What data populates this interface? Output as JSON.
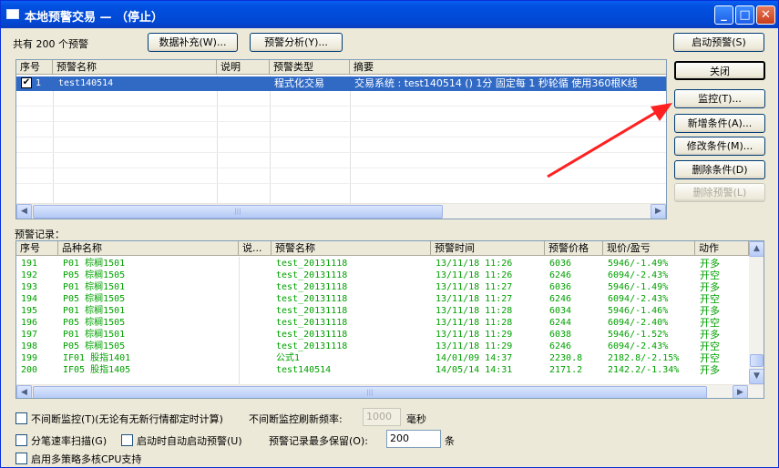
{
  "window": {
    "title": "本地预警交易 — （停止）"
  },
  "top": {
    "count_label": "共有 200 个预警",
    "data_supplement_btn": "数据补充(W)...",
    "alert_analysis_btn": "预警分析(Y)...",
    "start_alert_btn": "启动预警(S)"
  },
  "alerts_table": {
    "headers": [
      "序号",
      "预警名称",
      "说明",
      "预警类型",
      "摘要"
    ],
    "rows": [
      {
        "index": "1",
        "checked": true,
        "name": "test140514",
        "desc": "",
        "type": "程式化交易",
        "summary": "交易系统 : test140514 () 1分 固定每 1 秒轮循 使用360根K线"
      }
    ]
  },
  "side_buttons": {
    "close": "关闭",
    "monitor": "监控(T)...",
    "add_condition": "新增条件(A)...",
    "modify_condition": "修改条件(M)...",
    "delete_condition": "删除条件(D)",
    "delete_alert": "删除预警(L)"
  },
  "records": {
    "title": "预警记录：",
    "headers": [
      "序号",
      "品种名称",
      "说...",
      "预警名称",
      "预警时间",
      "预警价格",
      "现价/盈亏",
      "动作"
    ],
    "rows": [
      {
        "no": "191",
        "product": "P01  棕榈1501",
        "note": "",
        "alert": "test_20131118",
        "time": "13/11/18 11:26",
        "price": "6036",
        "pnl": "5946/-1.49%",
        "action": "开多"
      },
      {
        "no": "192",
        "product": "P05  棕榈1505",
        "note": "",
        "alert": "test_20131118",
        "time": "13/11/18 11:26",
        "price": "6246",
        "pnl": "6094/-2.43%",
        "action": "开空"
      },
      {
        "no": "193",
        "product": "P01  棕榈1501",
        "note": "",
        "alert": "test_20131118",
        "time": "13/11/18 11:27",
        "price": "6036",
        "pnl": "5946/-1.49%",
        "action": "开多"
      },
      {
        "no": "194",
        "product": "P05  棕榈1505",
        "note": "",
        "alert": "test_20131118",
        "time": "13/11/18 11:27",
        "price": "6246",
        "pnl": "6094/-2.43%",
        "action": "开空"
      },
      {
        "no": "195",
        "product": "P01  棕榈1501",
        "note": "",
        "alert": "test_20131118",
        "time": "13/11/18 11:28",
        "price": "6034",
        "pnl": "5946/-1.46%",
        "action": "开多"
      },
      {
        "no": "196",
        "product": "P05  棕榈1505",
        "note": "",
        "alert": "test_20131118",
        "time": "13/11/18 11:28",
        "price": "6244",
        "pnl": "6094/-2.40%",
        "action": "开空"
      },
      {
        "no": "197",
        "product": "P01  棕榈1501",
        "note": "",
        "alert": "test_20131118",
        "time": "13/11/18 11:29",
        "price": "6038",
        "pnl": "5946/-1.52%",
        "action": "开多"
      },
      {
        "no": "198",
        "product": "P05  棕榈1505",
        "note": "",
        "alert": "test_20131118",
        "time": "13/11/18 11:29",
        "price": "6246",
        "pnl": "6094/-2.43%",
        "action": "开空"
      },
      {
        "no": "199",
        "product": "IF01  股指1401",
        "note": "",
        "alert": "公式1",
        "time": "14/01/09 14:37",
        "price": "2230.8",
        "pnl": "2182.8/-2.15%",
        "action": "开空"
      },
      {
        "no": "200",
        "product": "IF05  股指1405",
        "note": "",
        "alert": "test140514",
        "time": "14/05/14 14:31",
        "price": "2171.2",
        "pnl": "2142.2/-1.34%",
        "action": "开多"
      }
    ]
  },
  "bottom": {
    "continuous_monitor": "不间断监控(T)(无论有无新行情都定时计算)",
    "refresh_freq_label": "不间断监控刷新频率:",
    "refresh_freq_value": "1000",
    "ms_unit": "毫秒",
    "split_scan": "分笔速率扫描(G)",
    "auto_start": "启动时自动启动预警(U)",
    "max_records_label": "预警记录最多保留(O):",
    "max_records_value": "200",
    "records_unit": "条",
    "multi_core": "启用多策略多核CPU支持"
  },
  "colors": {
    "record_text": "#00a000",
    "selection": "#316ac5",
    "arrow": "#ff2020"
  }
}
